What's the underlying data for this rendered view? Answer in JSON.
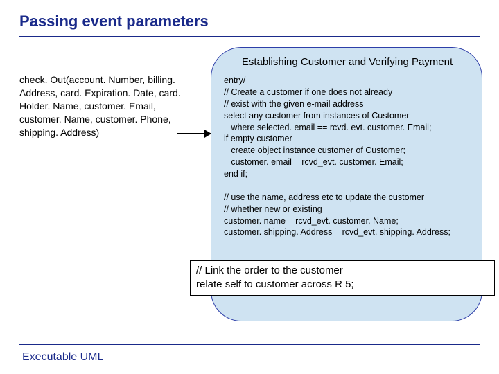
{
  "title": "Passing event parameters",
  "footer": "Executable UML",
  "event_call": "check. Out(account. Number, billing. Address, card. Expiration. Date, card. Holder. Name, customer. Email, customer. Name, customer. Phone, shipping. Address)",
  "state": {
    "title": "Establishing Customer and Verifying Payment",
    "body_lines": [
      "entry/",
      "// Create a customer if one does not already",
      "// exist with the given e-mail address",
      "select any customer from instances of Customer",
      "   where selected. email == rcvd. evt. customer. Email;",
      "if empty customer",
      "   create object instance customer of Customer;",
      "   customer. email = rcvd_evt. customer. Email;",
      "end if;",
      "",
      "// use the name, address etc to update the customer",
      "// whether new or existing",
      "customer. name = rcvd_evt. customer. Name;",
      "customer. shipping. Address = rcvd_evt. shipping. Address;"
    ]
  },
  "overlay_lines": [
    "// Link the order to the customer",
    "relate self to customer across R 5;"
  ]
}
